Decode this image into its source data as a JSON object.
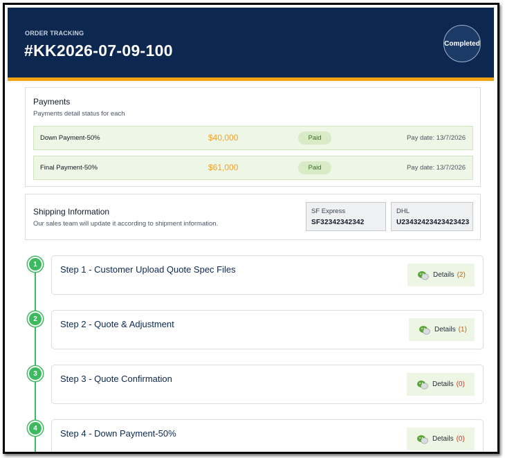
{
  "header": {
    "eyebrow": "ORDER TRACKING",
    "order_id": "#KK2026-07-09-100",
    "status": "Completed"
  },
  "payments": {
    "title": "Payments",
    "subtitle": "Payments detail status for each",
    "rows": [
      {
        "label": "Down Payment-50%",
        "amount": "$40,000",
        "status": "Paid",
        "date": "Pay date: 13/7/2026"
      },
      {
        "label": "Final Payment-50%",
        "amount": "$61,000",
        "status": "Paid",
        "date": "Pay date: 13/7/2026"
      }
    ]
  },
  "shipping": {
    "title": "Shipping Information",
    "subtitle": "Our sales team will update it according to shipment information.",
    "carriers": [
      {
        "name": "SF Express",
        "tracking": "SF32342342342"
      },
      {
        "name": "DHL",
        "tracking": "U23432423423423423"
      }
    ]
  },
  "steps": [
    {
      "number": "1",
      "title": "Step 1 - Customer Upload Quote Spec Files",
      "details_label": "Details",
      "count": "(2)"
    },
    {
      "number": "2",
      "title": "Step 2 - Quote & Adjustment",
      "details_label": "Details",
      "count": "(1)"
    },
    {
      "number": "3",
      "title": "Step 3 - Quote Confirmation",
      "details_label": "Details",
      "count": "(0)"
    },
    {
      "number": "4",
      "title": "Step 4 - Down Payment-50%",
      "details_label": "Details",
      "count": "(0)"
    }
  ],
  "colors": {
    "header_bg": "#0c2850",
    "accent_stripe": "#f2a313",
    "amount": "#f0a12b",
    "timeline": "#3dba5f",
    "count_nonzero": "#b5651d",
    "count_zero": "#c0392b"
  },
  "icons": {
    "details": "chat-bubbles-icon"
  }
}
